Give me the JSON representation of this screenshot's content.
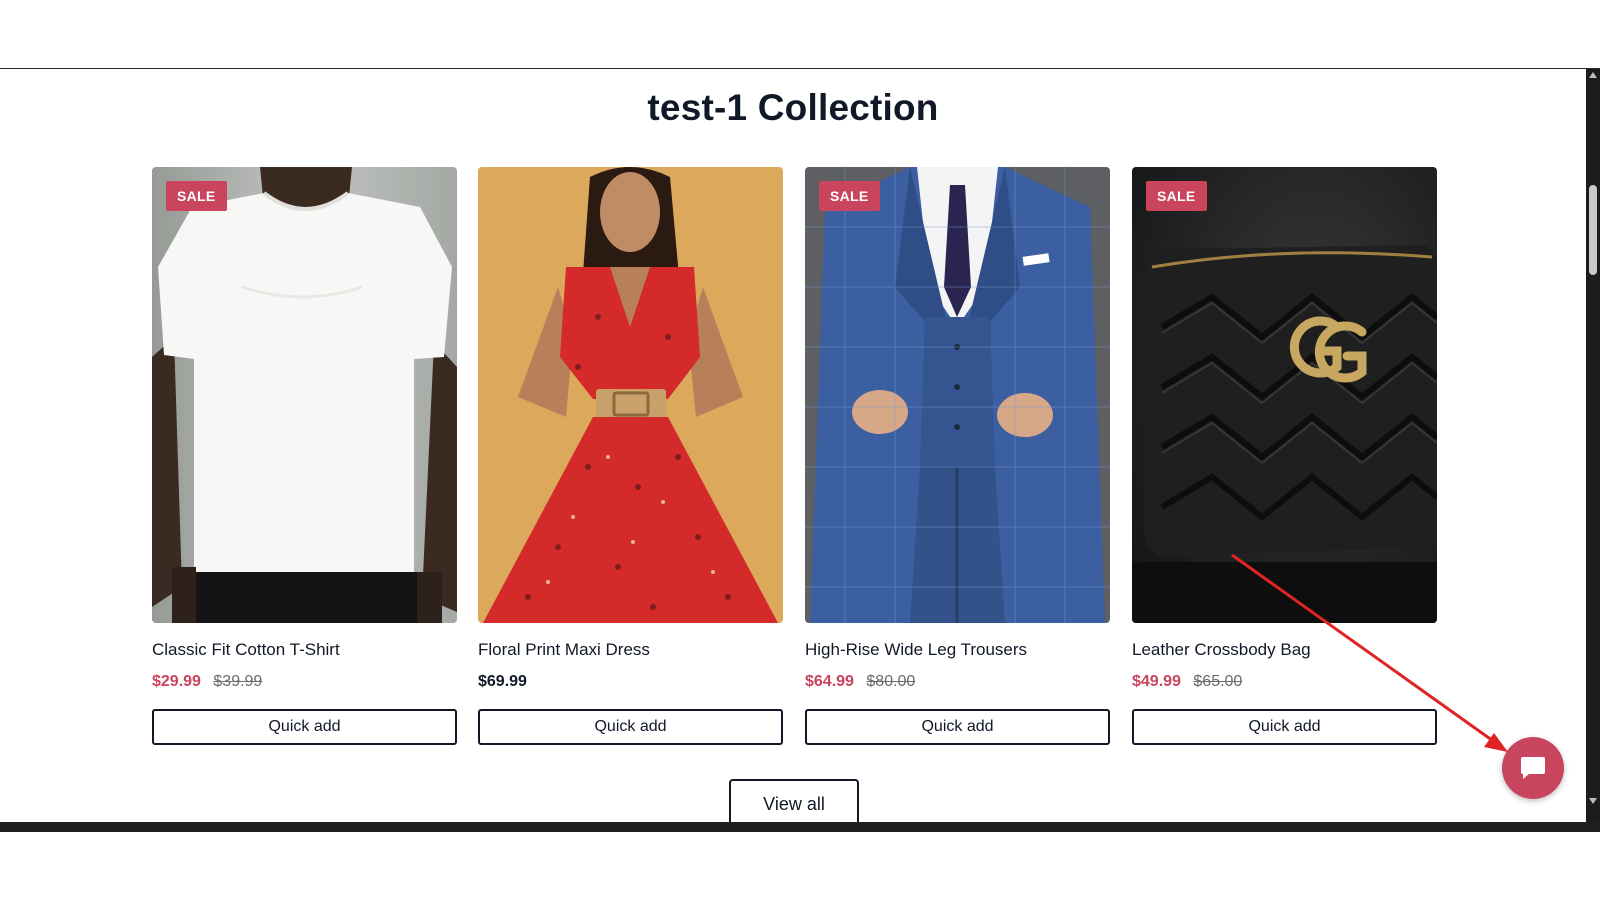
{
  "collection": {
    "title": "test-1 Collection",
    "view_all_label": "View all"
  },
  "products": [
    {
      "name": "Classic Fit Cotton T-Shirt",
      "badge": "SALE",
      "price": "$29.99",
      "compare_price": "$39.99",
      "button_label": "Quick add",
      "image": "white-tshirt-model"
    },
    {
      "name": "Floral Print Maxi Dress",
      "badge": "",
      "price": "$69.99",
      "compare_price": "",
      "button_label": "Quick add",
      "image": "red-floral-dress-model"
    },
    {
      "name": "High-Rise Wide Leg Trousers",
      "badge": "SALE",
      "price": "$64.99",
      "compare_price": "$80.00",
      "button_label": "Quick add",
      "image": "blue-check-suit-model"
    },
    {
      "name": "Leather Crossbody Bag",
      "badge": "SALE",
      "price": "$49.99",
      "compare_price": "$65.00",
      "button_label": "Quick add",
      "image": "black-quilted-bag"
    }
  ],
  "chat_widget": {
    "icon": "chat-bubble-icon"
  },
  "colors": {
    "sale_accent": "#c9455e",
    "text": "#111827",
    "annotation_arrow": "#e02424"
  }
}
